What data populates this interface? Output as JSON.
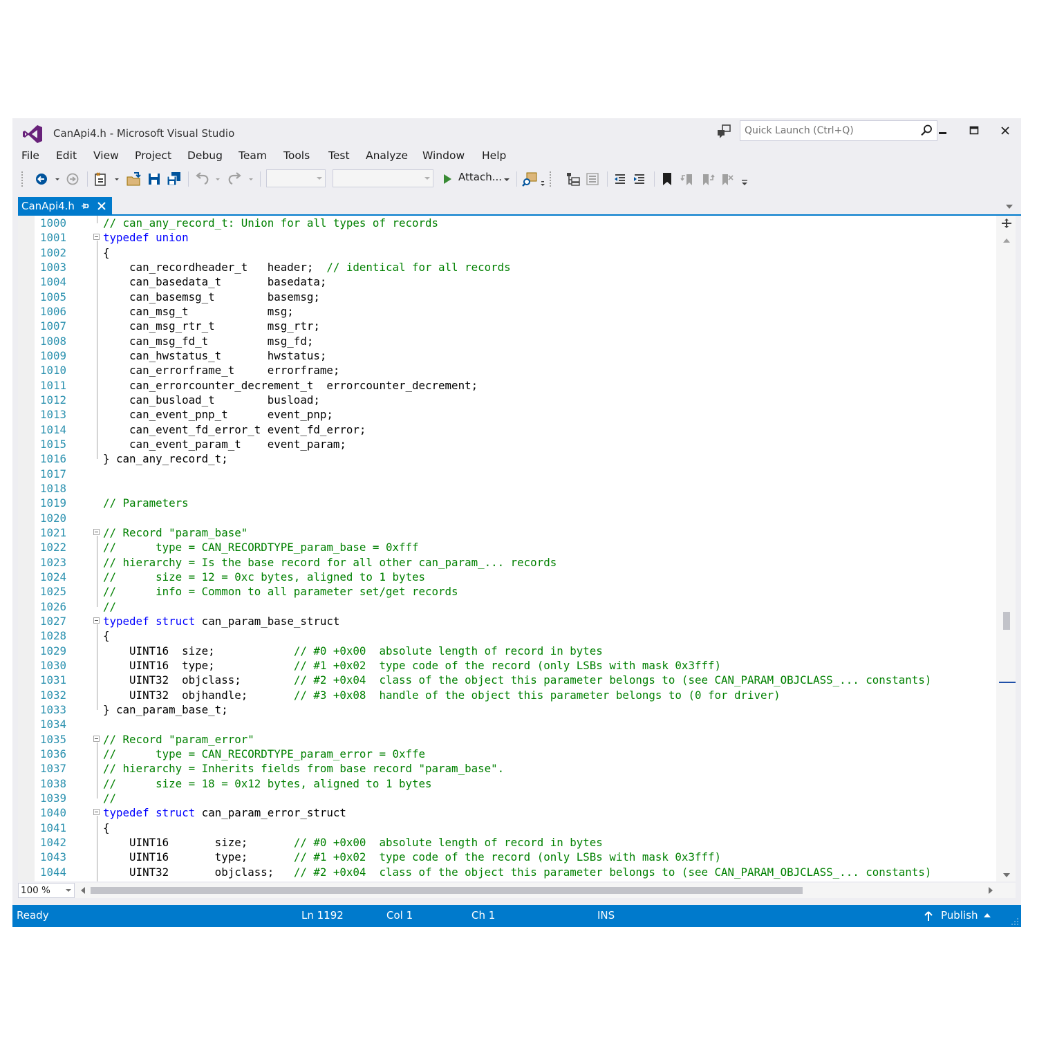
{
  "window": {
    "title": "CanApi4.h - Microsoft Visual Studio",
    "quick_launch_placeholder": "Quick Launch (Ctrl+Q)"
  },
  "menu": [
    "File",
    "Edit",
    "View",
    "Project",
    "Debug",
    "Team",
    "Tools",
    "Test",
    "Analyze",
    "Window",
    "Help"
  ],
  "toolbar": {
    "attach_label": "Attach...",
    "attach_color": "#388a34"
  },
  "tab": {
    "label": "CanApi4.h",
    "accent": "#007acc"
  },
  "editor": {
    "lines": [
      {
        "n": "1000",
        "fold": false,
        "parts": [
          {
            "t": "// can_any_record_t: Union for all types of records",
            "c": "cm"
          }
        ]
      },
      {
        "n": "1001",
        "fold": true,
        "parts": [
          {
            "t": "typedef",
            "c": "kw"
          },
          {
            "t": " "
          },
          {
            "t": "union",
            "c": "kw"
          }
        ]
      },
      {
        "n": "1002",
        "fold": false,
        "parts": [
          {
            "t": "{"
          }
        ]
      },
      {
        "n": "1003",
        "fold": false,
        "parts": [
          {
            "t": "    can_recordheader_t   header;  "
          },
          {
            "t": "// identical for all records",
            "c": "cm"
          }
        ]
      },
      {
        "n": "1004",
        "fold": false,
        "parts": [
          {
            "t": "    can_basedata_t       basedata;"
          }
        ]
      },
      {
        "n": "1005",
        "fold": false,
        "parts": [
          {
            "t": "    can_basemsg_t        basemsg;"
          }
        ]
      },
      {
        "n": "1006",
        "fold": false,
        "parts": [
          {
            "t": "    can_msg_t            msg;"
          }
        ]
      },
      {
        "n": "1007",
        "fold": false,
        "parts": [
          {
            "t": "    can_msg_rtr_t        msg_rtr;"
          }
        ]
      },
      {
        "n": "1008",
        "fold": false,
        "parts": [
          {
            "t": "    can_msg_fd_t         msg_fd;"
          }
        ]
      },
      {
        "n": "1009",
        "fold": false,
        "parts": [
          {
            "t": "    can_hwstatus_t       hwstatus;"
          }
        ]
      },
      {
        "n": "1010",
        "fold": false,
        "parts": [
          {
            "t": "    can_errorframe_t     errorframe;"
          }
        ]
      },
      {
        "n": "1011",
        "fold": false,
        "parts": [
          {
            "t": "    can_errorcounter_decrement_t  errorcounter_decrement;"
          }
        ]
      },
      {
        "n": "1012",
        "fold": false,
        "parts": [
          {
            "t": "    can_busload_t        busload;"
          }
        ]
      },
      {
        "n": "1013",
        "fold": false,
        "parts": [
          {
            "t": "    can_event_pnp_t      event_pnp;"
          }
        ]
      },
      {
        "n": "1014",
        "fold": false,
        "parts": [
          {
            "t": "    can_event_fd_error_t event_fd_error;"
          }
        ]
      },
      {
        "n": "1015",
        "fold": false,
        "parts": [
          {
            "t": "    can_event_param_t    event_param;"
          }
        ]
      },
      {
        "n": "1016",
        "fold": false,
        "parts": [
          {
            "t": "} can_any_record_t;"
          }
        ]
      },
      {
        "n": "1017",
        "fold": false,
        "parts": []
      },
      {
        "n": "1018",
        "fold": false,
        "parts": []
      },
      {
        "n": "1019",
        "fold": false,
        "parts": [
          {
            "t": "// Parameters",
            "c": "cm"
          }
        ]
      },
      {
        "n": "1020",
        "fold": false,
        "parts": []
      },
      {
        "n": "1021",
        "fold": true,
        "parts": [
          {
            "t": "// Record \"param_base\"",
            "c": "cm"
          }
        ]
      },
      {
        "n": "1022",
        "fold": false,
        "parts": [
          {
            "t": "//      type = CAN_RECORDTYPE_param_base = 0xfff",
            "c": "cm"
          }
        ]
      },
      {
        "n": "1023",
        "fold": false,
        "parts": [
          {
            "t": "// hierarchy = Is the base record for all other can_param_... records",
            "c": "cm"
          }
        ]
      },
      {
        "n": "1024",
        "fold": false,
        "parts": [
          {
            "t": "//      size = 12 = 0xc bytes, aligned to 1 bytes",
            "c": "cm"
          }
        ]
      },
      {
        "n": "1025",
        "fold": false,
        "parts": [
          {
            "t": "//      info = Common to all parameter set/get records",
            "c": "cm"
          }
        ]
      },
      {
        "n": "1026",
        "fold": false,
        "parts": [
          {
            "t": "//",
            "c": "cm"
          }
        ]
      },
      {
        "n": "1027",
        "fold": true,
        "parts": [
          {
            "t": "typedef",
            "c": "kw"
          },
          {
            "t": " "
          },
          {
            "t": "struct",
            "c": "kw"
          },
          {
            "t": " can_param_base_struct"
          }
        ]
      },
      {
        "n": "1028",
        "fold": false,
        "parts": [
          {
            "t": "{"
          }
        ]
      },
      {
        "n": "1029",
        "fold": false,
        "parts": [
          {
            "t": "    UINT16  size;            "
          },
          {
            "t": "// #0 +0x00  absolute length of record in bytes",
            "c": "cm"
          }
        ]
      },
      {
        "n": "1030",
        "fold": false,
        "parts": [
          {
            "t": "    UINT16  type;            "
          },
          {
            "t": "// #1 +0x02  type code of the record (only LSBs with mask 0x3fff)",
            "c": "cm"
          }
        ]
      },
      {
        "n": "1031",
        "fold": false,
        "parts": [
          {
            "t": "    UINT32  objclass;        "
          },
          {
            "t": "// #2 +0x04  class of the object this parameter belongs to (see CAN_PARAM_OBJCLASS_... constants)",
            "c": "cm"
          }
        ]
      },
      {
        "n": "1032",
        "fold": false,
        "parts": [
          {
            "t": "    UINT32  objhandle;       "
          },
          {
            "t": "// #3 +0x08  handle of the object this parameter belongs to (0 for driver)",
            "c": "cm"
          }
        ]
      },
      {
        "n": "1033",
        "fold": false,
        "parts": [
          {
            "t": "} can_param_base_t;"
          }
        ]
      },
      {
        "n": "1034",
        "fold": false,
        "parts": []
      },
      {
        "n": "1035",
        "fold": true,
        "parts": [
          {
            "t": "// Record \"param_error\"",
            "c": "cm"
          }
        ]
      },
      {
        "n": "1036",
        "fold": false,
        "parts": [
          {
            "t": "//      type = CAN_RECORDTYPE_param_error = 0xffe",
            "c": "cm"
          }
        ]
      },
      {
        "n": "1037",
        "fold": false,
        "parts": [
          {
            "t": "// hierarchy = Inherits fields from base record \"param_base\".",
            "c": "cm"
          }
        ]
      },
      {
        "n": "1038",
        "fold": false,
        "parts": [
          {
            "t": "//      size = 18 = 0x12 bytes, aligned to 1 bytes",
            "c": "cm"
          }
        ]
      },
      {
        "n": "1039",
        "fold": false,
        "parts": [
          {
            "t": "//",
            "c": "cm"
          }
        ]
      },
      {
        "n": "1040",
        "fold": true,
        "parts": [
          {
            "t": "typedef",
            "c": "kw"
          },
          {
            "t": " "
          },
          {
            "t": "struct",
            "c": "kw"
          },
          {
            "t": " can_param_error_struct"
          }
        ]
      },
      {
        "n": "1041",
        "fold": false,
        "parts": [
          {
            "t": "{"
          }
        ]
      },
      {
        "n": "1042",
        "fold": false,
        "parts": [
          {
            "t": "    UINT16       size;       "
          },
          {
            "t": "// #0 +0x00  absolute length of record in bytes",
            "c": "cm"
          }
        ]
      },
      {
        "n": "1043",
        "fold": false,
        "parts": [
          {
            "t": "    UINT16       type;       "
          },
          {
            "t": "// #1 +0x02  type code of the record (only LSBs with mask 0x3fff)",
            "c": "cm"
          }
        ]
      },
      {
        "n": "1044",
        "fold": false,
        "parts": [
          {
            "t": "    UINT32       objclass;   "
          },
          {
            "t": "// #2 +0x04  class of the object this parameter belongs to (see CAN_PARAM_OBJCLASS_... constants)",
            "c": "cm"
          }
        ]
      }
    ]
  },
  "bottom": {
    "zoom": "100 %"
  },
  "status": {
    "ready": "Ready",
    "line": "Ln 1192",
    "col": "Col 1",
    "ch": "Ch 1",
    "mode": "INS",
    "publish": "Publish",
    "color": "#007acc"
  }
}
